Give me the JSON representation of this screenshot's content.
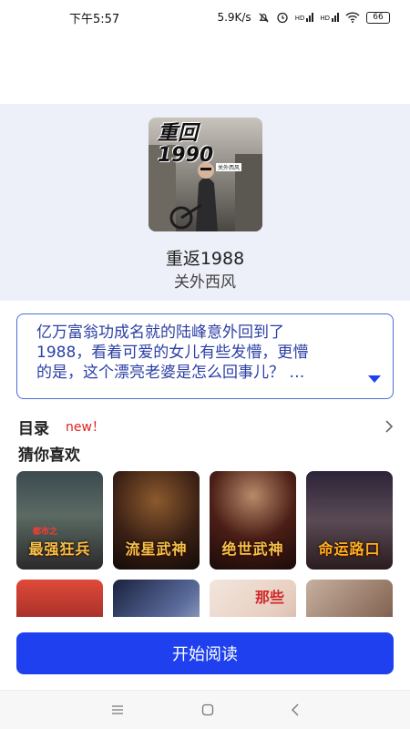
{
  "status_bar": {
    "time": "下午5:57",
    "network_speed": "5.9K/s",
    "signal_left": "HD",
    "signal_right": "HD",
    "battery": "66"
  },
  "book": {
    "title": "重返1988",
    "author": "关外西风",
    "cover_text": "重回1990",
    "cover_subtext": "关外西风"
  },
  "description": {
    "line1": "亿万富翁功成名就的陆峰意外回到了",
    "line2": "1988，看着可爱的女儿有些发懵，更懵",
    "line3": "的是，这个漂亮老婆是怎么回事儿？ …"
  },
  "catalog": {
    "title": "目录",
    "badge": "new！"
  },
  "recommend": {
    "title": "猜你喜欢",
    "books": [
      {
        "cover_text": "最强狂兵",
        "tag": "都市之"
      },
      {
        "cover_text": "流星武神"
      },
      {
        "cover_text": "绝世武神"
      },
      {
        "cover_text": "命运路口"
      },
      {
        "cover_text": ""
      },
      {
        "cover_text": ""
      },
      {
        "cover_text": "那些"
      },
      {
        "cover_text": ""
      }
    ]
  },
  "cta": {
    "label": "开始阅读"
  },
  "colors": {
    "accent": "#1e40ef",
    "link_text": "#2c3fa6",
    "hero_bg": "#eef0f9",
    "new_badge": "#e02020"
  },
  "icons": [
    "mute-icon",
    "alarm-icon",
    "signal-icon",
    "wifi-icon",
    "battery-icon",
    "expand-arrow-icon",
    "chevron-right-icon",
    "menu-icon",
    "home-icon",
    "back-icon"
  ]
}
